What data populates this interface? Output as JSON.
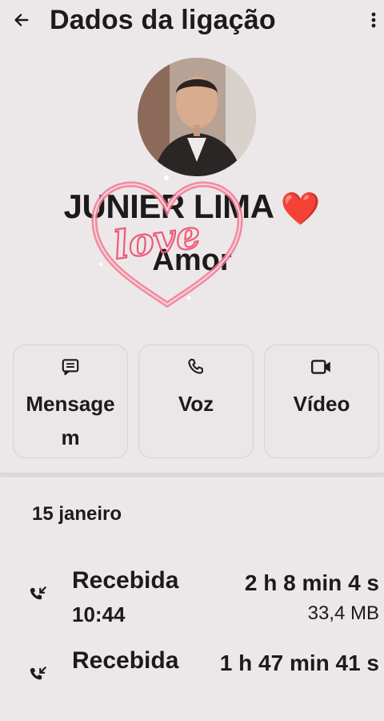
{
  "header": {
    "title": "Dados da ligação",
    "back_icon": "arrow-left-icon",
    "more_icon": "more-vertical-icon"
  },
  "contact": {
    "name": "JUNIER LIMA",
    "emoji": "❤️",
    "nickname": "Amor",
    "overlay_text": "love",
    "overlay_color": "#f05a78"
  },
  "actions": [
    {
      "label": "Mensagem",
      "icon": "message-icon"
    },
    {
      "label": "Voz",
      "icon": "phone-icon"
    },
    {
      "label": "Vídeo",
      "icon": "video-icon"
    }
  ],
  "history": {
    "date": "15 janeiro",
    "calls": [
      {
        "type": "Recebida",
        "time": "10:44",
        "duration": "2 h 8 min 4 s",
        "size": "33,4 MB",
        "icon": "incoming-call-icon"
      },
      {
        "type": "Recebida",
        "time": "",
        "duration": "1 h 47 min 41 s",
        "size": "",
        "icon": "incoming-call-icon"
      }
    ]
  },
  "colors": {
    "background": "#ece7e9",
    "text": "#1d1a1b",
    "heart": "#d83545"
  }
}
